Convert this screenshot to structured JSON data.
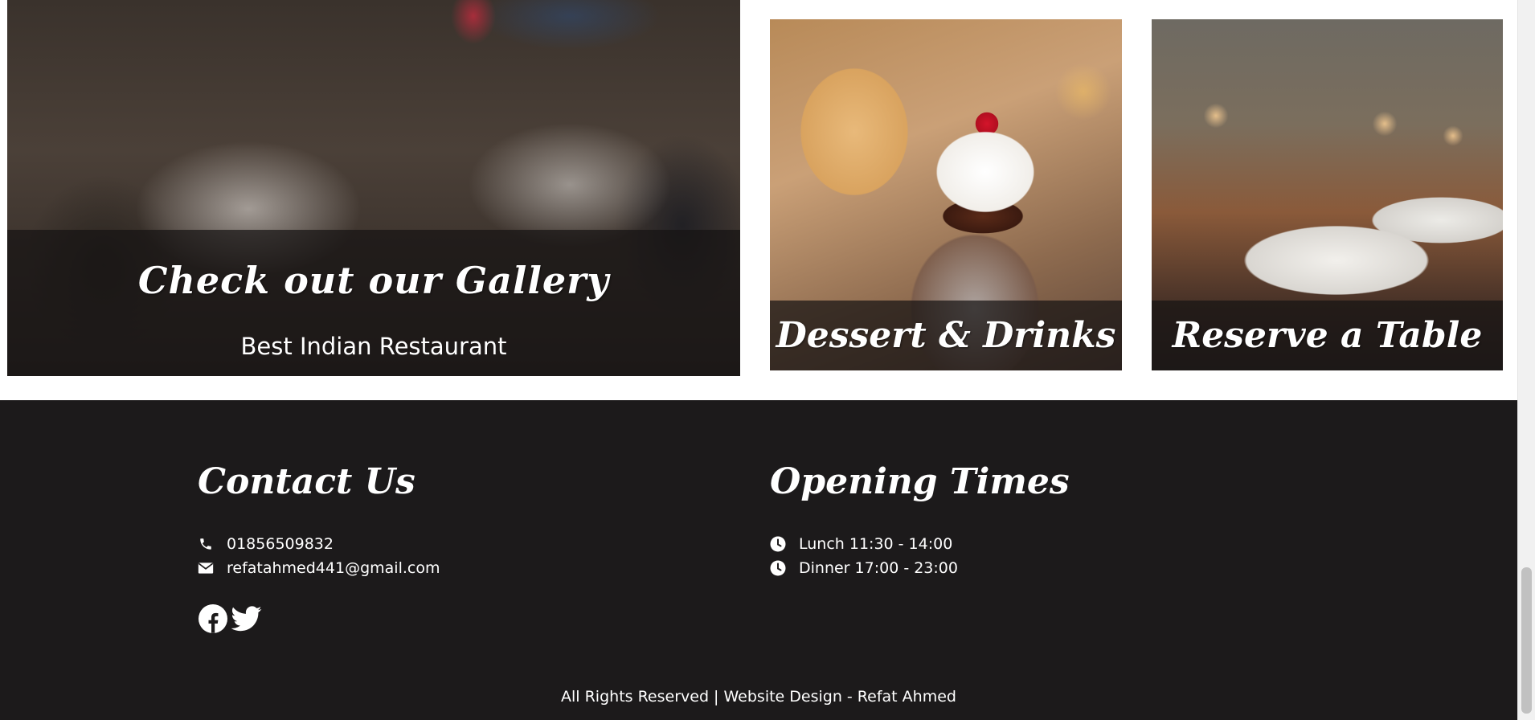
{
  "gallery": {
    "main_title": "Check out our Gallery",
    "main_subtitle": "Best Indian Restaurant",
    "tiles": [
      {
        "label": "Dessert & Drinks"
      },
      {
        "label": "Reserve a Table"
      }
    ]
  },
  "footer": {
    "contact": {
      "heading": "Contact Us",
      "phone_icon": "phone-icon",
      "phone": "01856509832",
      "email_icon": "envelope-icon",
      "email": "refatahmed441@gmail.com"
    },
    "hours": {
      "heading": "Opening Times",
      "items": [
        {
          "icon": "clock-icon",
          "text": "Lunch 11:30 - 14:00"
        },
        {
          "icon": "clock-icon",
          "text": "Dinner 17:00 - 23:00"
        }
      ]
    },
    "social": [
      {
        "icon": "facebook-icon"
      },
      {
        "icon": "twitter-icon"
      }
    ],
    "copyright": "All Rights Reserved | Website Design - Refat Ahmed"
  },
  "colors": {
    "footer_bg": "#1c1a1b",
    "text": "#ffffff",
    "overlay": "rgba(22,20,20,0.72)"
  }
}
